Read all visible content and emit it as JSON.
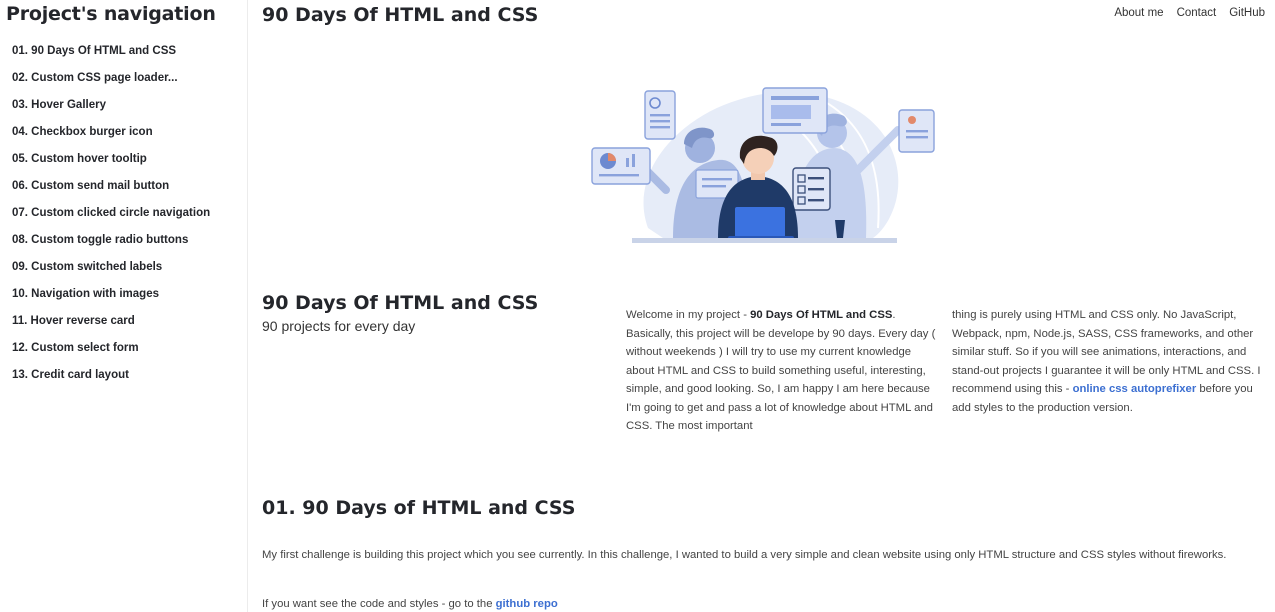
{
  "sidebar": {
    "title": "Project's navigation",
    "items": [
      {
        "label": "01.  90 Days Of HTML and CSS"
      },
      {
        "label": "02.  Custom CSS page loader..."
      },
      {
        "label": "03.  Hover Gallery"
      },
      {
        "label": "04.  Checkbox burger icon"
      },
      {
        "label": "05.  Custom hover tooltip"
      },
      {
        "label": "06.  Custom send mail button"
      },
      {
        "label": "07.  Custom clicked circle navigation"
      },
      {
        "label": "08.  Custom toggle radio buttons"
      },
      {
        "label": "09.  Custom switched labels"
      },
      {
        "label": "10.  Navigation with images"
      },
      {
        "label": "11.  Hover reverse card"
      },
      {
        "label": "12.  Custom select form"
      },
      {
        "label": "13.  Credit card layout"
      }
    ]
  },
  "header": {
    "title": "90 Days Of HTML and CSS",
    "links": {
      "about": "About me",
      "contact": "Contact",
      "github": "GitHub"
    }
  },
  "intro": {
    "title": "90 Days Of HTML and CSS",
    "subtitle": "90 projects for every day",
    "col1_pre": "Welcome in my project - ",
    "col1_bold": "90 Days Of HTML and CSS",
    "col1_post": ". Basically, this project will be develope by 90 days. Every day ( without weekends ) I will try to use my current knowledge about HTML and CSS to build something useful, interesting, simple, and good looking. So, I am happy I am here because I'm going to get and pass a lot of knowledge about HTML and CSS. The most important",
    "col2_pre": "thing is purely using HTML and CSS only. No JavaScript, Webpack, npm, Node.js, SASS, CSS frameworks, and other similar stuff. So if you will see animations, interactions, and stand-out projects I guarantee it will be only HTML and CSS. I recommend using this - ",
    "col2_link": "online css autoprefixer",
    "col2_post": " before you add styles to the production version."
  },
  "section1": {
    "title": "01. 90 Days of HTML and CSS",
    "paragraph": "My first challenge is building this project which you see currently. In this challenge, I wanted to build a very simple and clean website using only HTML structure and CSS styles without fireworks.",
    "code_pre": "If you want see the code and styles - go to the ",
    "code_link": "github repo"
  },
  "icons": {
    "hero": "developer-team-illustration"
  },
  "colors": {
    "accent": "#3c6fd1",
    "illustration_light": "#dfe6f7",
    "illustration_mid": "#a9bcec",
    "illustration_dark": "#1f3a68"
  }
}
